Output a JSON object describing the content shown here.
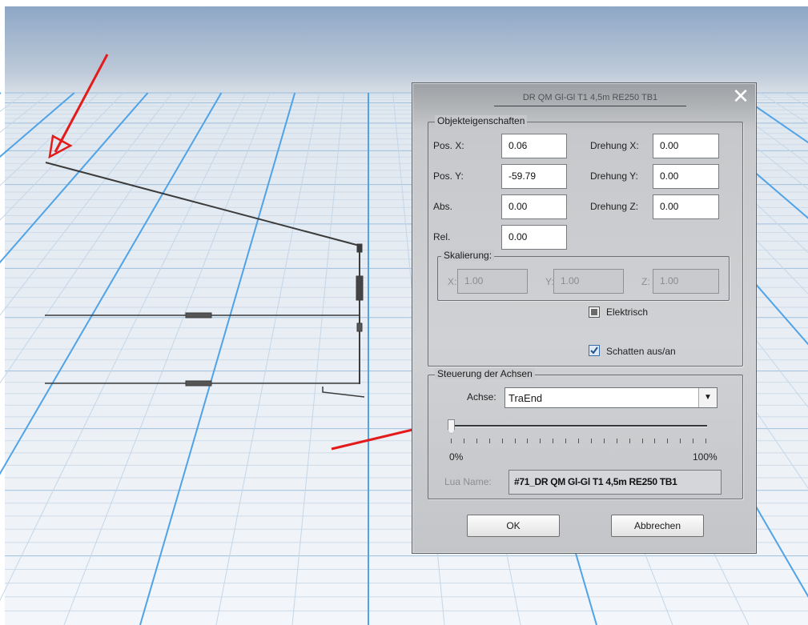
{
  "dialog": {
    "title": "DR QM Gl-Gl T1 4,5m RE250 TB1",
    "close_glyph": "✕",
    "group_properties": "Objekteigenschaften",
    "pos_x_label": "Pos. X:",
    "pos_x_value": "0.06",
    "pos_y_label": "Pos. Y:",
    "pos_y_value": "-59.79",
    "abs_label": "Abs.",
    "abs_value": "0.00",
    "rel_label": "Rel.",
    "rel_value": "0.00",
    "rot_x_label": "Drehung X:",
    "rot_x_value": "0.00",
    "rot_y_label": "Drehung Y:",
    "rot_y_value": "0.00",
    "rot_z_label": "Drehung Z:",
    "rot_z_value": "0.00",
    "scaling_label": "Skalierung:",
    "scale_x_label": "X:",
    "scale_x_value": "1.00",
    "scale_y_label": "Y:",
    "scale_y_value": "1.00",
    "scale_z_label": "Z:",
    "scale_z_value": "1.00",
    "elektrisch_label": "Elektrisch",
    "elektrisch_state": "indeterminate",
    "shadow_label": "Schatten aus/an",
    "shadow_checked": true,
    "group_axes": "Steuerung der Achsen",
    "axis_label": "Achse:",
    "axis_value": "TraEnd",
    "slider_value_percent": 0,
    "slider_min_label": "0%",
    "slider_max_label": "100%",
    "lua_label": "Lua Name:",
    "lua_value": "#71_DR QM Gl-Gl T1 4,5m RE250 TB1",
    "ok_label": "OK",
    "cancel_label": "Abbrechen"
  },
  "colors": {
    "sky_top": "#8ea8c8",
    "grid_ground": "#e9f0f7",
    "grid_line": "#4fa3e6",
    "annotation_arrow": "#e51b1b",
    "wire": "#3a3a3a"
  }
}
